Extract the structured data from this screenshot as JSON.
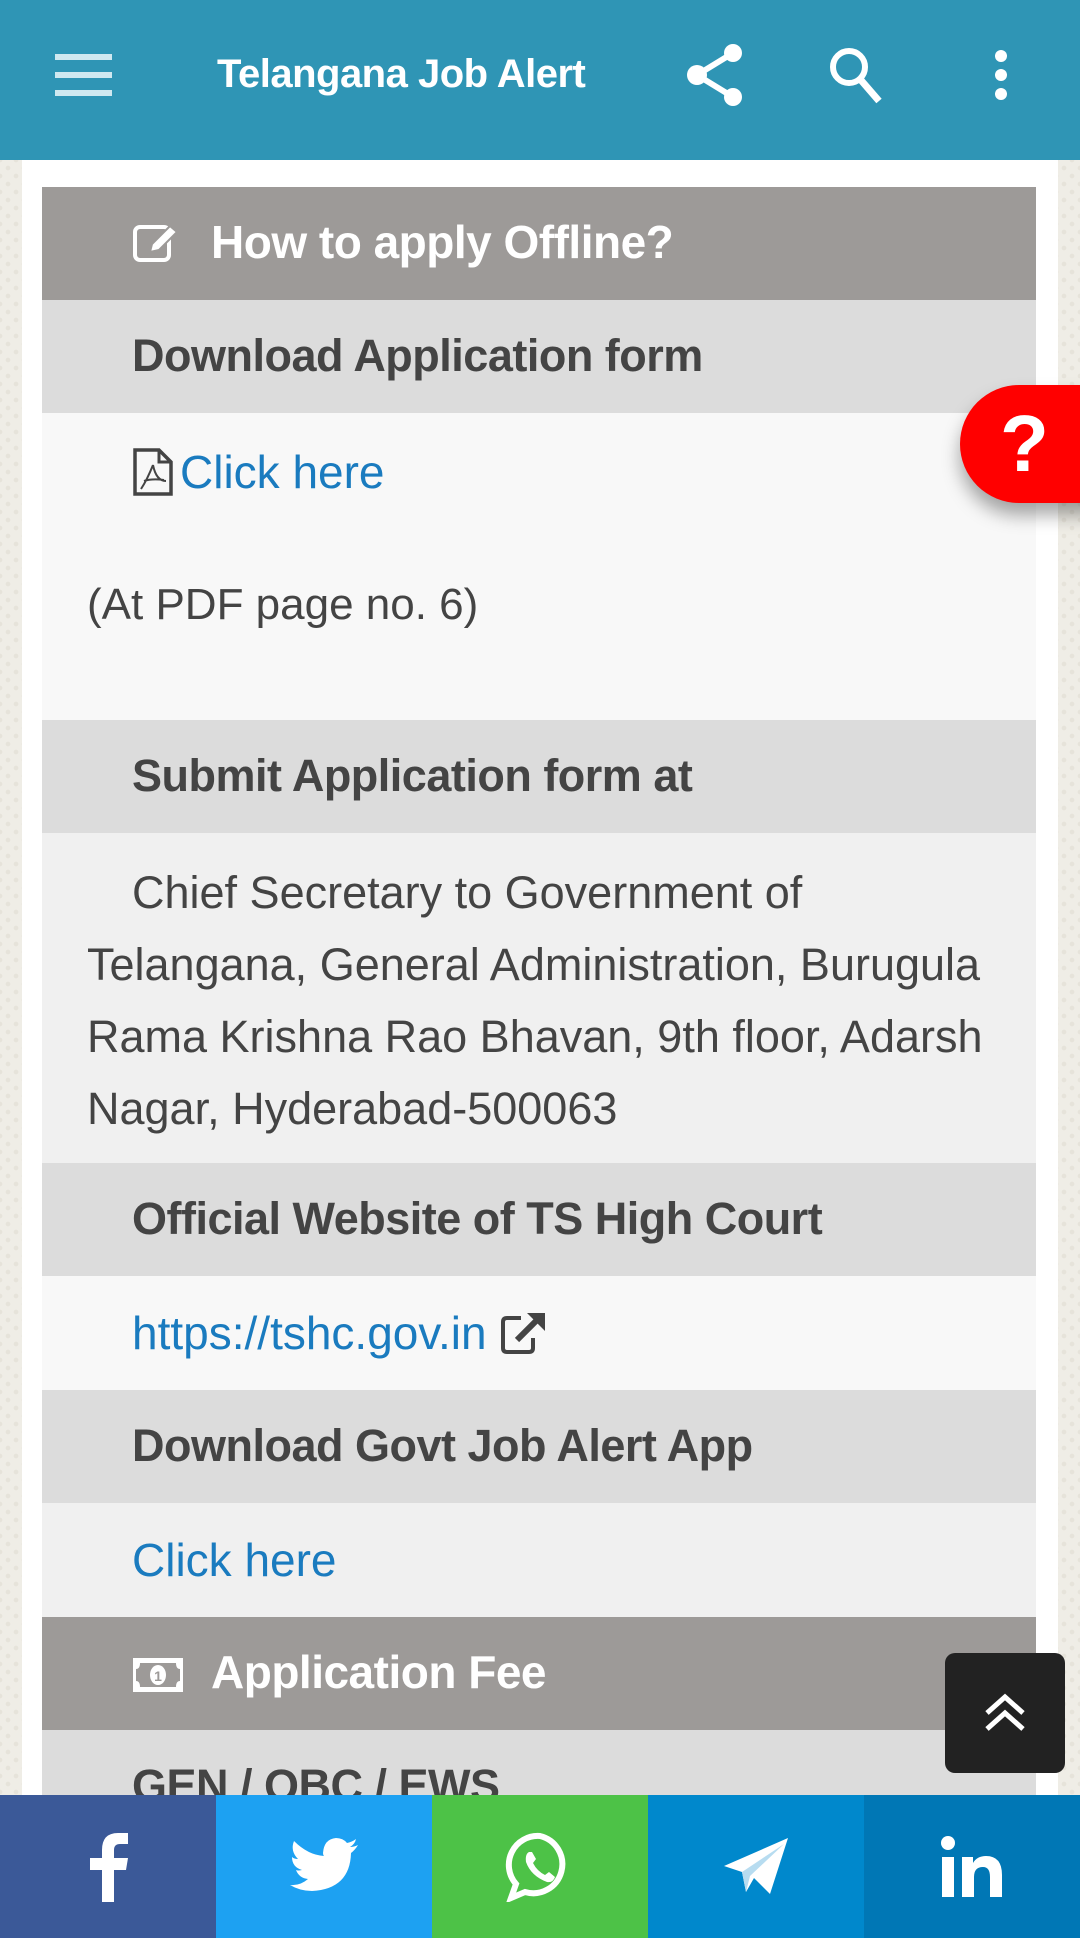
{
  "appbar": {
    "title": "Telangana Job Alert",
    "color": "#2f95b5",
    "icons": [
      "menu-icon",
      "share-icon",
      "search-icon",
      "more-vert-icon"
    ]
  },
  "sections": {
    "how_to_apply": {
      "icon": "edit-icon",
      "title": "How to apply Offline?"
    },
    "download_form": {
      "title": "Download Application form",
      "link_icon": "pdf-icon",
      "link_label": "Click here",
      "note": "(At PDF page no. 6)"
    },
    "submit_at": {
      "title": "Submit Application form at",
      "address": "Chief Secretary to Government of Telangana, General Administration, Burugula Rama Krishna Rao Bhavan, 9th floor, Adarsh Nagar, Hyderabad-500063"
    },
    "official_website": {
      "title": "Official Website of TS High Court",
      "url": "https://tshc.gov.in",
      "link_icon": "external-link-icon"
    },
    "download_app": {
      "title": "Download Govt Job Alert App",
      "link_label": "Click here"
    },
    "application_fee": {
      "icon": "money-icon",
      "title": "Application Fee"
    },
    "fee_category": {
      "title": "GEN / OBC / EWS"
    }
  },
  "floating": {
    "help_label": "?",
    "help_color": "#ff0000",
    "scroll_top_icon": "double-chevron-up-icon"
  },
  "share_bar": [
    {
      "name": "facebook",
      "icon": "facebook-icon",
      "color": "#3b5998"
    },
    {
      "name": "twitter",
      "icon": "twitter-icon",
      "color": "#1da1f2"
    },
    {
      "name": "whatsapp",
      "icon": "whatsapp-icon",
      "color": "#4dc247"
    },
    {
      "name": "telegram",
      "icon": "telegram-icon",
      "color": "#0088cc"
    },
    {
      "name": "linkedin",
      "icon": "linkedin-icon",
      "color": "#0077b5"
    }
  ]
}
